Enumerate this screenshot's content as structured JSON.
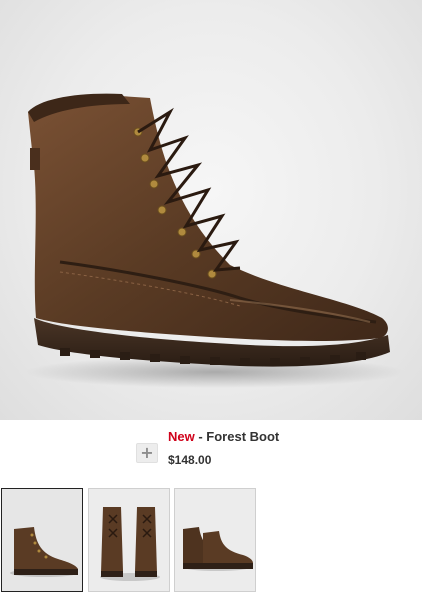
{
  "product": {
    "badge": "New",
    "separator": " - ",
    "name": "Forest Boot",
    "price": "$148.00"
  },
  "actions": {
    "add_glyph": "+"
  },
  "thumbnails": [
    {
      "view": "side",
      "selected": true
    },
    {
      "view": "front-pair",
      "selected": false
    },
    {
      "view": "side-pair",
      "selected": false
    }
  ],
  "colors": {
    "badge": "#d0021b",
    "leather": "#5a3b24",
    "sole": "#3a2a1e"
  }
}
